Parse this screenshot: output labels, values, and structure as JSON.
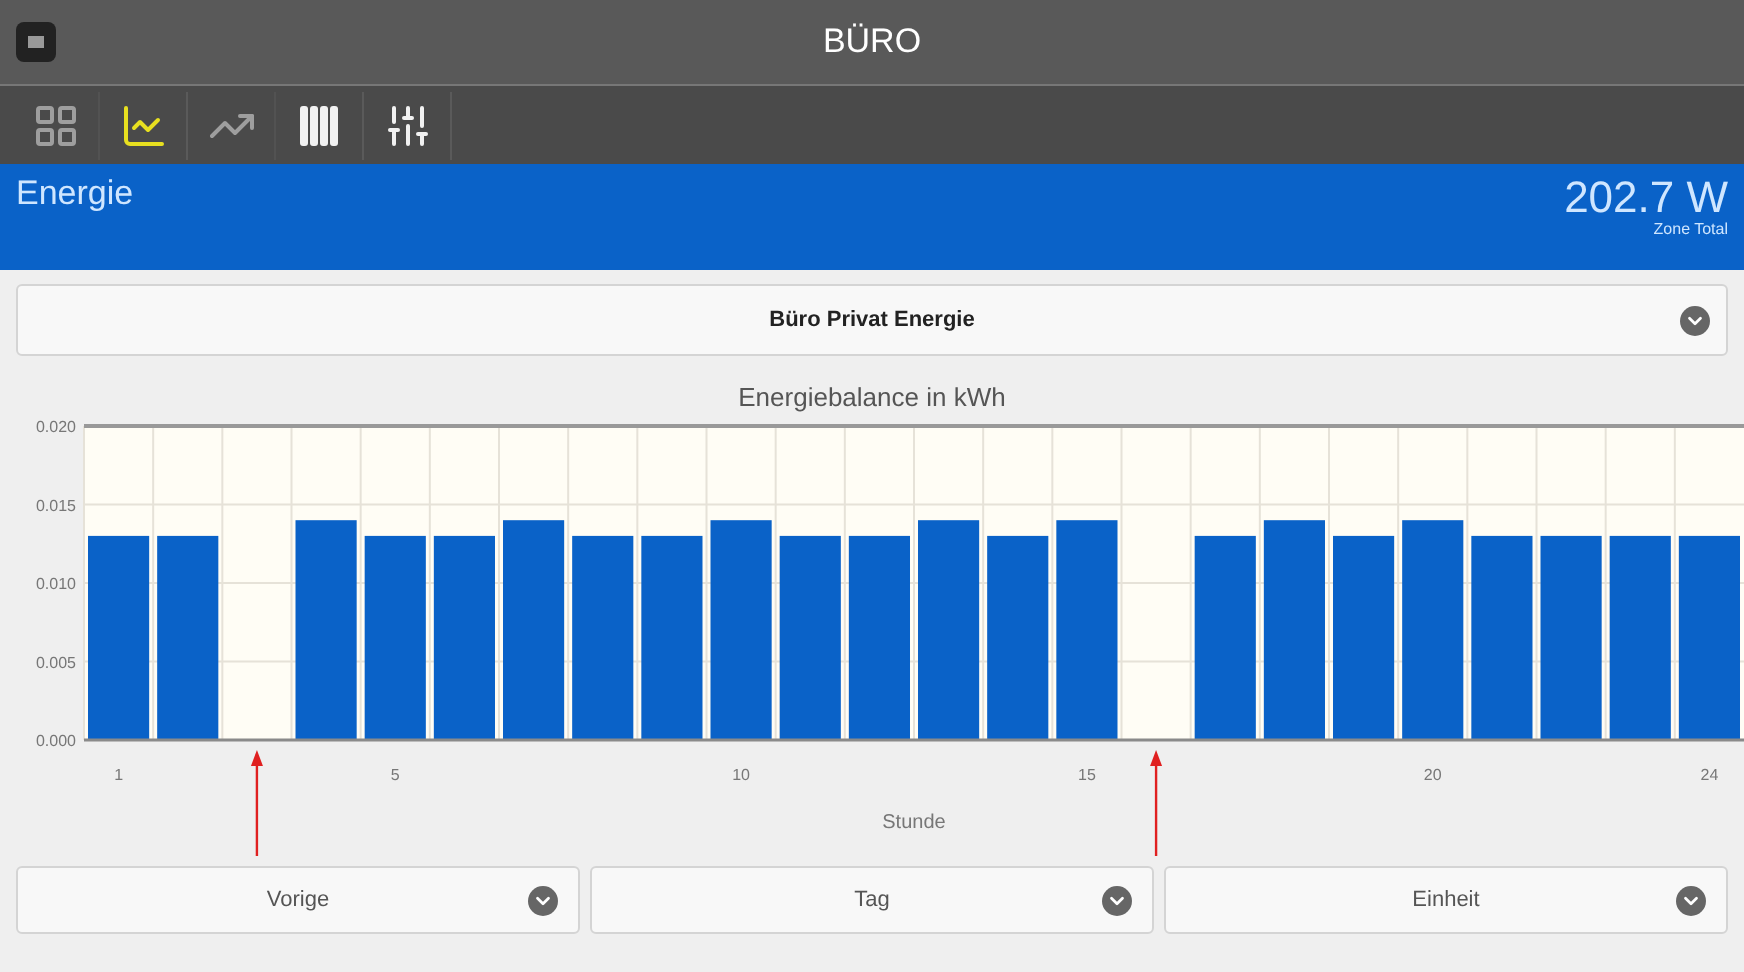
{
  "window": {
    "title": "BÜRO"
  },
  "tabs": [
    {
      "selected": false,
      "disabled": true
    },
    {
      "selected": true,
      "disabled": false
    },
    {
      "selected": false,
      "disabled": true
    },
    {
      "selected": false,
      "disabled": false
    },
    {
      "selected": false,
      "disabled": false
    }
  ],
  "header": {
    "title": "Energie",
    "value": "202.7 W",
    "value_caption": "Zone Total"
  },
  "selector": {
    "label": "Büro Privat Energie"
  },
  "chart": {
    "chart_data": {
      "type": "bar",
      "title": "Energiebalance in kWh",
      "xlabel": "Stunde",
      "x": [
        1,
        2,
        3,
        4,
        5,
        6,
        7,
        8,
        9,
        10,
        11,
        12,
        13,
        14,
        15,
        16,
        17,
        18,
        19,
        20,
        21,
        22,
        23,
        24
      ],
      "grid": true,
      "values": [
        0.013,
        0.013,
        0,
        0.014,
        0.013,
        0.013,
        0.014,
        0.013,
        0.013,
        0.014,
        0.013,
        0.013,
        0.014,
        0.013,
        0.014,
        0,
        0.013,
        0.014,
        0.013,
        0.014,
        0.013,
        0.013,
        0.013,
        0.013
      ],
      "ylim": [
        0,
        0.02
      ],
      "yticks": [
        {
          "value": 0,
          "label": "0.000"
        },
        {
          "value": 0.005,
          "label": "0.005"
        },
        {
          "value": 0.01,
          "label": "0.010"
        },
        {
          "value": 0.015,
          "label": "0.015"
        },
        {
          "value": 0.02,
          "label": "0.020"
        }
      ],
      "xlim": [
        0.5,
        24.5
      ],
      "xticks": [
        1,
        5,
        10,
        15,
        20,
        24
      ]
    }
  },
  "buttons": [
    {
      "label": "Vorige"
    },
    {
      "label": "Tag"
    },
    {
      "label": "Einheit"
    }
  ]
}
